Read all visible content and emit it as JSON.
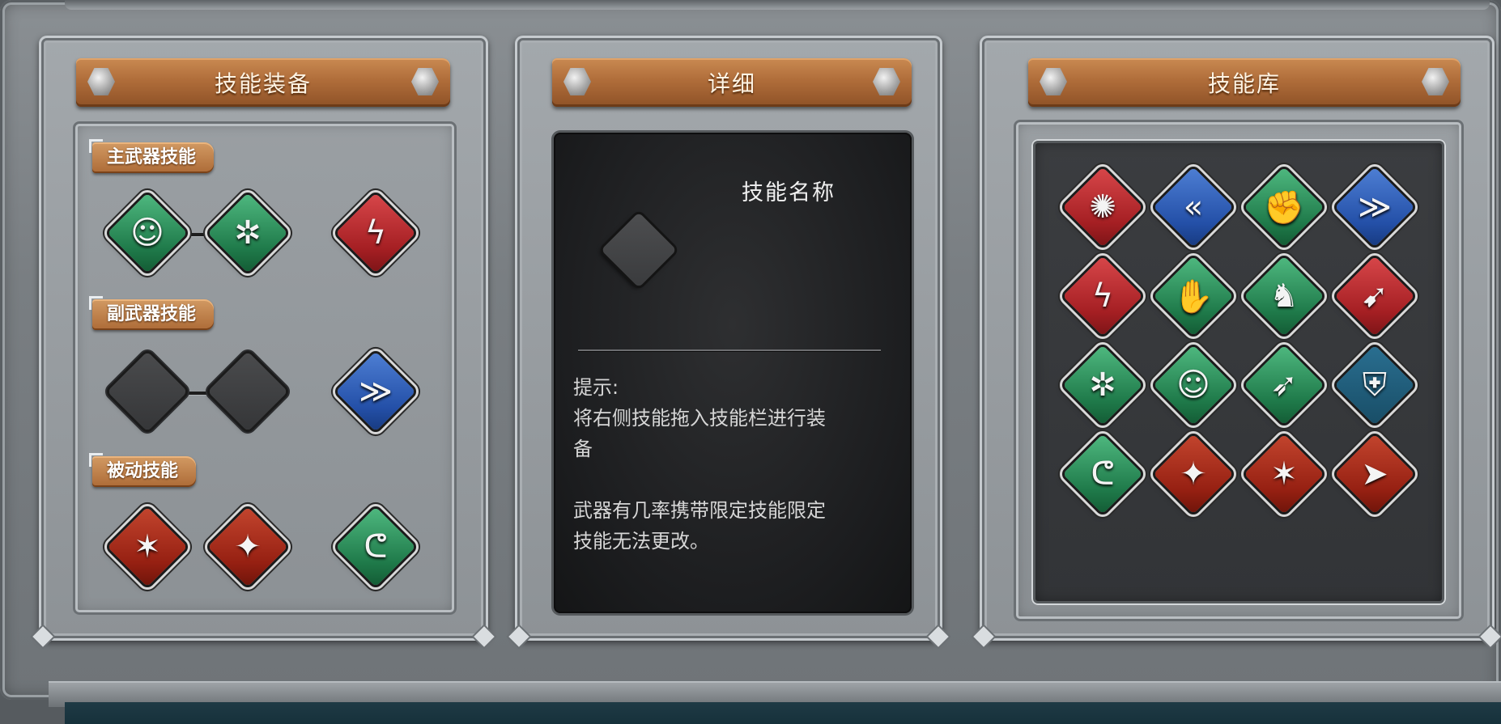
{
  "panels": {
    "equip": {
      "title": "技能装备"
    },
    "detail": {
      "title": "详细"
    },
    "library": {
      "title": "技能库"
    }
  },
  "equip": {
    "sections": [
      {
        "label": "主武器技能"
      },
      {
        "label": "副武器技能"
      },
      {
        "label": "被动技能"
      }
    ]
  },
  "detail": {
    "skill_name": "技能名称",
    "hint_title": "提示:",
    "hint_line1": "将右侧技能拖入技能栏进行装",
    "hint_line2": "备",
    "hint_line3": "武器有几率携带限定技能限定",
    "hint_line4": "技能无法更改。"
  },
  "icons": {
    "primary": [
      "brain-icon",
      "burst-figure-icon",
      "lightning-icon"
    ],
    "secondary": [
      "empty-slot",
      "empty-slot",
      "wind-slash-icon"
    ],
    "passive": [
      "star-sword-icon",
      "sparkle-sword-icon",
      "muscle-arm-icon"
    ],
    "library": [
      "dragon-claw-icon",
      "dash-kick-icon",
      "fist-icon",
      "wind-slash-icon",
      "lightning-icon",
      "praying-hands-icon",
      "runner-shield-icon",
      "flying-kick-icon",
      "burst-figure-icon",
      "brain-icon",
      "dodge-figure-icon",
      "shield-icon",
      "muscle-arm-icon",
      "sparkle-sword-icon",
      "star-sword-icon",
      "vortex-arrow-icon"
    ]
  },
  "colors": {
    "green": "#2a8a57",
    "red": "#b02a2d",
    "blue": "#2c5bb4",
    "wood": "#b06d3a"
  }
}
